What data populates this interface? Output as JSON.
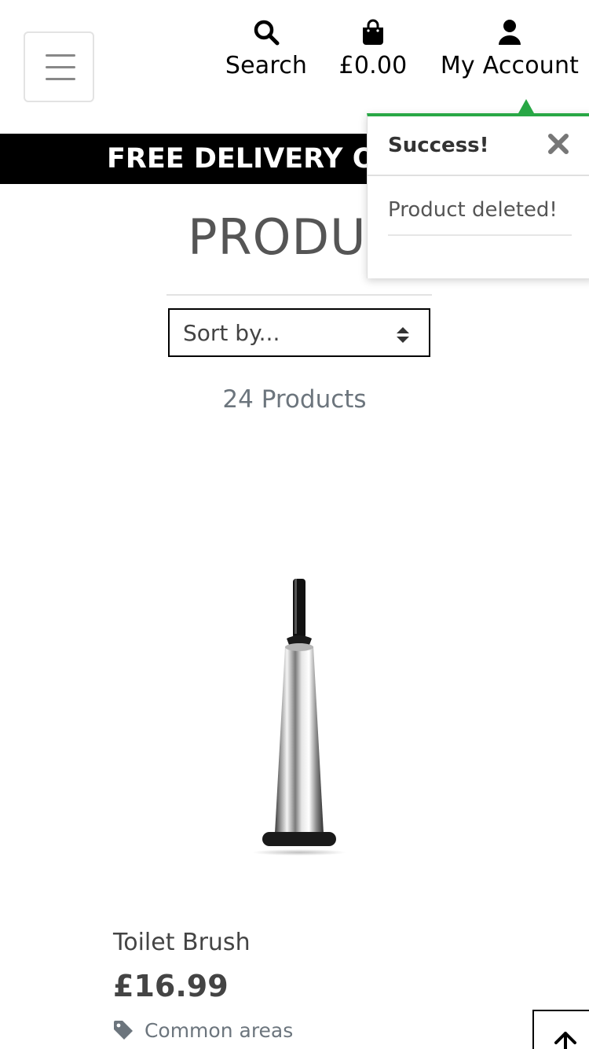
{
  "header": {
    "menu_label": "",
    "nav": [
      {
        "label": "Search",
        "icon": "search-icon"
      },
      {
        "label": "£0.00",
        "icon": "shopping-bag-icon"
      },
      {
        "label": "My Account",
        "icon": "user-icon"
      }
    ]
  },
  "banner": {
    "text": "FREE DELIVERY OV"
  },
  "page": {
    "title": "PRODUC"
  },
  "sort": {
    "value": "Sort by..."
  },
  "results": {
    "count": "24 Products"
  },
  "products": [
    {
      "name": "Toilet Brush",
      "price": "£16.99",
      "category": "Common areas",
      "image": "toilet-brush-image"
    }
  ],
  "toast": {
    "title": "Success!",
    "message": "Product deleted!",
    "accent_color": "#28a745"
  },
  "colors": {
    "banner_bg": "#000000",
    "text": "#555555",
    "muted": "#6c757d"
  }
}
